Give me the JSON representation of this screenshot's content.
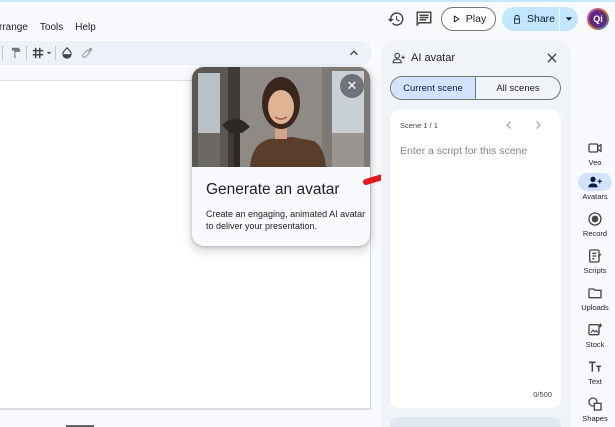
{
  "menu": {
    "items": [
      "rrange",
      "Tools",
      "Help"
    ]
  },
  "header": {
    "play_label": "Play",
    "share_label": "Share",
    "avatar_initials": "Qi"
  },
  "popover": {
    "title": "Generate an avatar",
    "body": "Create an engaging, animated AI avatar to deliver your presentation."
  },
  "panel": {
    "title": "AI avatar",
    "tabs": [
      "Current scene",
      "All scenes"
    ],
    "active_tab": "Current scene",
    "scene_label": "Scene 1 / 1",
    "script_placeholder": "Enter a script for this scene",
    "script_value": "",
    "char_count": "0/500"
  },
  "rail": {
    "items": [
      {
        "label": "Veo",
        "icon": "veo-icon"
      },
      {
        "label": "Avatars",
        "icon": "avatars-icon",
        "active": true
      },
      {
        "label": "Record",
        "icon": "record-icon"
      },
      {
        "label": "Scripts",
        "icon": "scripts-icon"
      },
      {
        "label": "Uploads",
        "icon": "folder-icon"
      },
      {
        "label": "Stock",
        "icon": "stock-icon"
      },
      {
        "label": "Text",
        "icon": "text-icon"
      },
      {
        "label": "Shapes",
        "icon": "shapes-icon"
      }
    ]
  },
  "colors": {
    "accent": "#c2e7ff",
    "active_tab": "#d3e3fd",
    "arrow": "#e8191c",
    "panel_bg": "#f0f4f9"
  }
}
